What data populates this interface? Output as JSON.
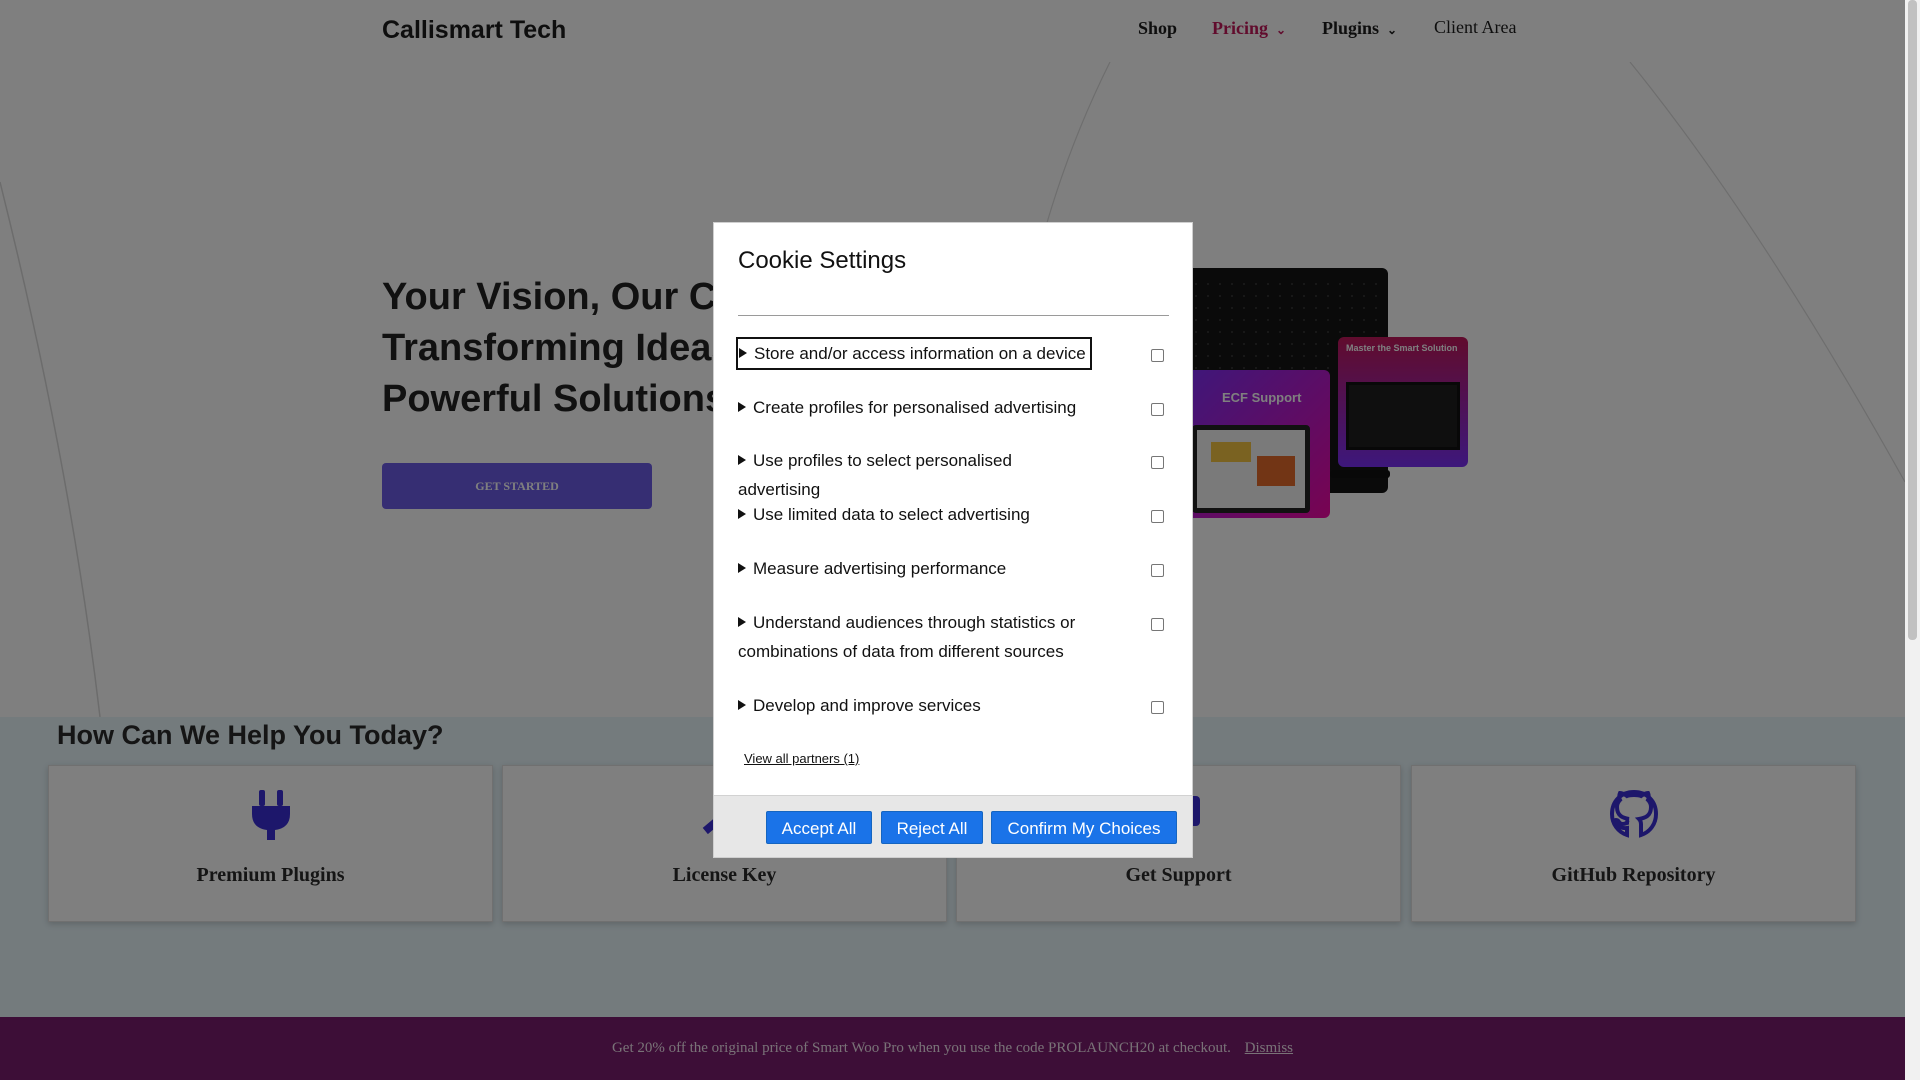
{
  "header": {
    "brand": "Callismart Tech",
    "nav": [
      {
        "label": "Shop"
      },
      {
        "label": "Pricing"
      },
      {
        "label": "Plugins"
      },
      {
        "label": "Client Area"
      }
    ]
  },
  "hero": {
    "title_line1": "Your Vision, Our Co",
    "title_line2": "Transforming Ideas",
    "title_line3": "Powerful Solutions.",
    "cta": "GET STARTED",
    "mockup_text_1": "ECF Support",
    "mockup_text_2": "Master the Smart Solution"
  },
  "help": {
    "title": "How Can We Help You Today?",
    "cards": [
      {
        "label": "Premium Plugins",
        "icon": "plug-icon"
      },
      {
        "label": "License Key",
        "icon": "key-icon"
      },
      {
        "label": "Get Support",
        "icon": "support-icon"
      },
      {
        "label": "GitHub Repository",
        "icon": "github-icon"
      }
    ]
  },
  "promo": {
    "text": "Get 20% off the original price of Smart Woo Pro when you use the code PROLAUNCH20 at checkout.",
    "dismiss": "Dismiss"
  },
  "cookie_modal": {
    "title": "Cookie Settings",
    "purposes": [
      {
        "label": "Store and/or access information on a device",
        "checked": false
      },
      {
        "label": "Create profiles for personalised advertising",
        "checked": false
      },
      {
        "label": "Use profiles to select personalised advertising",
        "checked": false
      },
      {
        "label": "Use limited data to select advertising",
        "checked": false
      },
      {
        "label": "Measure advertising performance",
        "checked": false
      },
      {
        "label": "Understand audiences through statistics or combinations of data from different sources",
        "checked": false
      },
      {
        "label": "Develop and improve services",
        "checked": false
      }
    ],
    "view_partners": "View all partners (1)",
    "buttons": {
      "accept_all": "Accept All",
      "reject_all": "Reject All",
      "confirm": "Confirm My Choices"
    }
  },
  "colors": {
    "primary_button": "#1a73e8",
    "accent_purple": "#6c5ce7",
    "promo_bar": "#7a1d6e",
    "nav_active": "#c2185b",
    "icon_blue": "#3b2fd6"
  }
}
